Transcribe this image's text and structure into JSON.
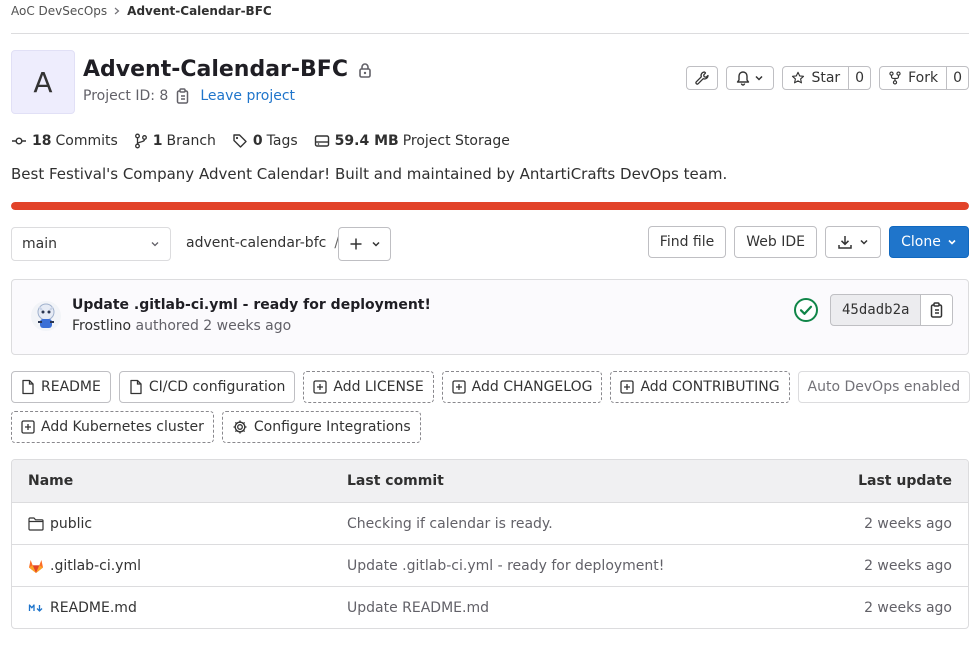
{
  "breadcrumb": {
    "group": "AoC DevSecOps",
    "project": "Advent-Calendar-BFC"
  },
  "project": {
    "avatar_letter": "A",
    "name": "Advent-Calendar-BFC",
    "id_text": "Project ID: 8",
    "leave_label": "Leave project",
    "description": "Best Festival's Company Advent Calendar! Built and maintained by AntartiCrafts DevOps team."
  },
  "header_actions": {
    "star_label": "Star",
    "star_count": "0",
    "fork_label": "Fork",
    "fork_count": "0"
  },
  "stats": {
    "commits_count": "18",
    "commits_label": "Commits",
    "branches_count": "1",
    "branches_label": "Branch",
    "tags_count": "0",
    "tags_label": "Tags",
    "storage_size": "59.4 MB",
    "storage_label": "Project Storage"
  },
  "language_bar": {
    "color": "#e24329",
    "fraction": 1.0
  },
  "repo_toolbar": {
    "branch": "main",
    "path": "advent-calendar-bfc",
    "path_sep": "/",
    "find_file": "Find file",
    "web_ide": "Web IDE",
    "clone": "Clone"
  },
  "last_commit": {
    "title": "Update .gitlab-ci.yml - ready for deployment!",
    "author": "Frostlino",
    "authored": "authored",
    "time": "2 weeks ago",
    "sha": "45dadb2a",
    "status": "passed",
    "status_color": "#108548"
  },
  "quick_links": [
    {
      "label": "README",
      "style": "solid",
      "icon": "file-icon"
    },
    {
      "label": "CI/CD configuration",
      "style": "solid",
      "icon": "file-icon"
    },
    {
      "label": "Add LICENSE",
      "style": "dashed",
      "icon": "plus-square-icon"
    },
    {
      "label": "Add CHANGELOG",
      "style": "dashed",
      "icon": "plus-square-icon"
    },
    {
      "label": "Add CONTRIBUTING",
      "style": "dashed",
      "icon": "plus-square-icon"
    },
    {
      "label": "Auto DevOps enabled",
      "style": "disabled",
      "icon": ""
    },
    {
      "label": "Add Kubernetes cluster",
      "style": "dashed",
      "icon": "plus-square-icon"
    },
    {
      "label": "Configure Integrations",
      "style": "dashed",
      "icon": "gear-icon"
    }
  ],
  "file_table": {
    "headers": {
      "name": "Name",
      "last_commit": "Last commit",
      "last_update": "Last update"
    },
    "rows": [
      {
        "name": "public",
        "icon": "folder-icon",
        "commit": "Checking if calendar is ready.",
        "updated": "2 weeks ago"
      },
      {
        "name": ".gitlab-ci.yml",
        "icon": "gitlab-icon",
        "commit": "Update .gitlab-ci.yml - ready for deployment!",
        "updated": "2 weeks ago"
      },
      {
        "name": "README.md",
        "icon": "markdown-icon",
        "commit": "Update README.md",
        "updated": "2 weeks ago"
      }
    ]
  }
}
